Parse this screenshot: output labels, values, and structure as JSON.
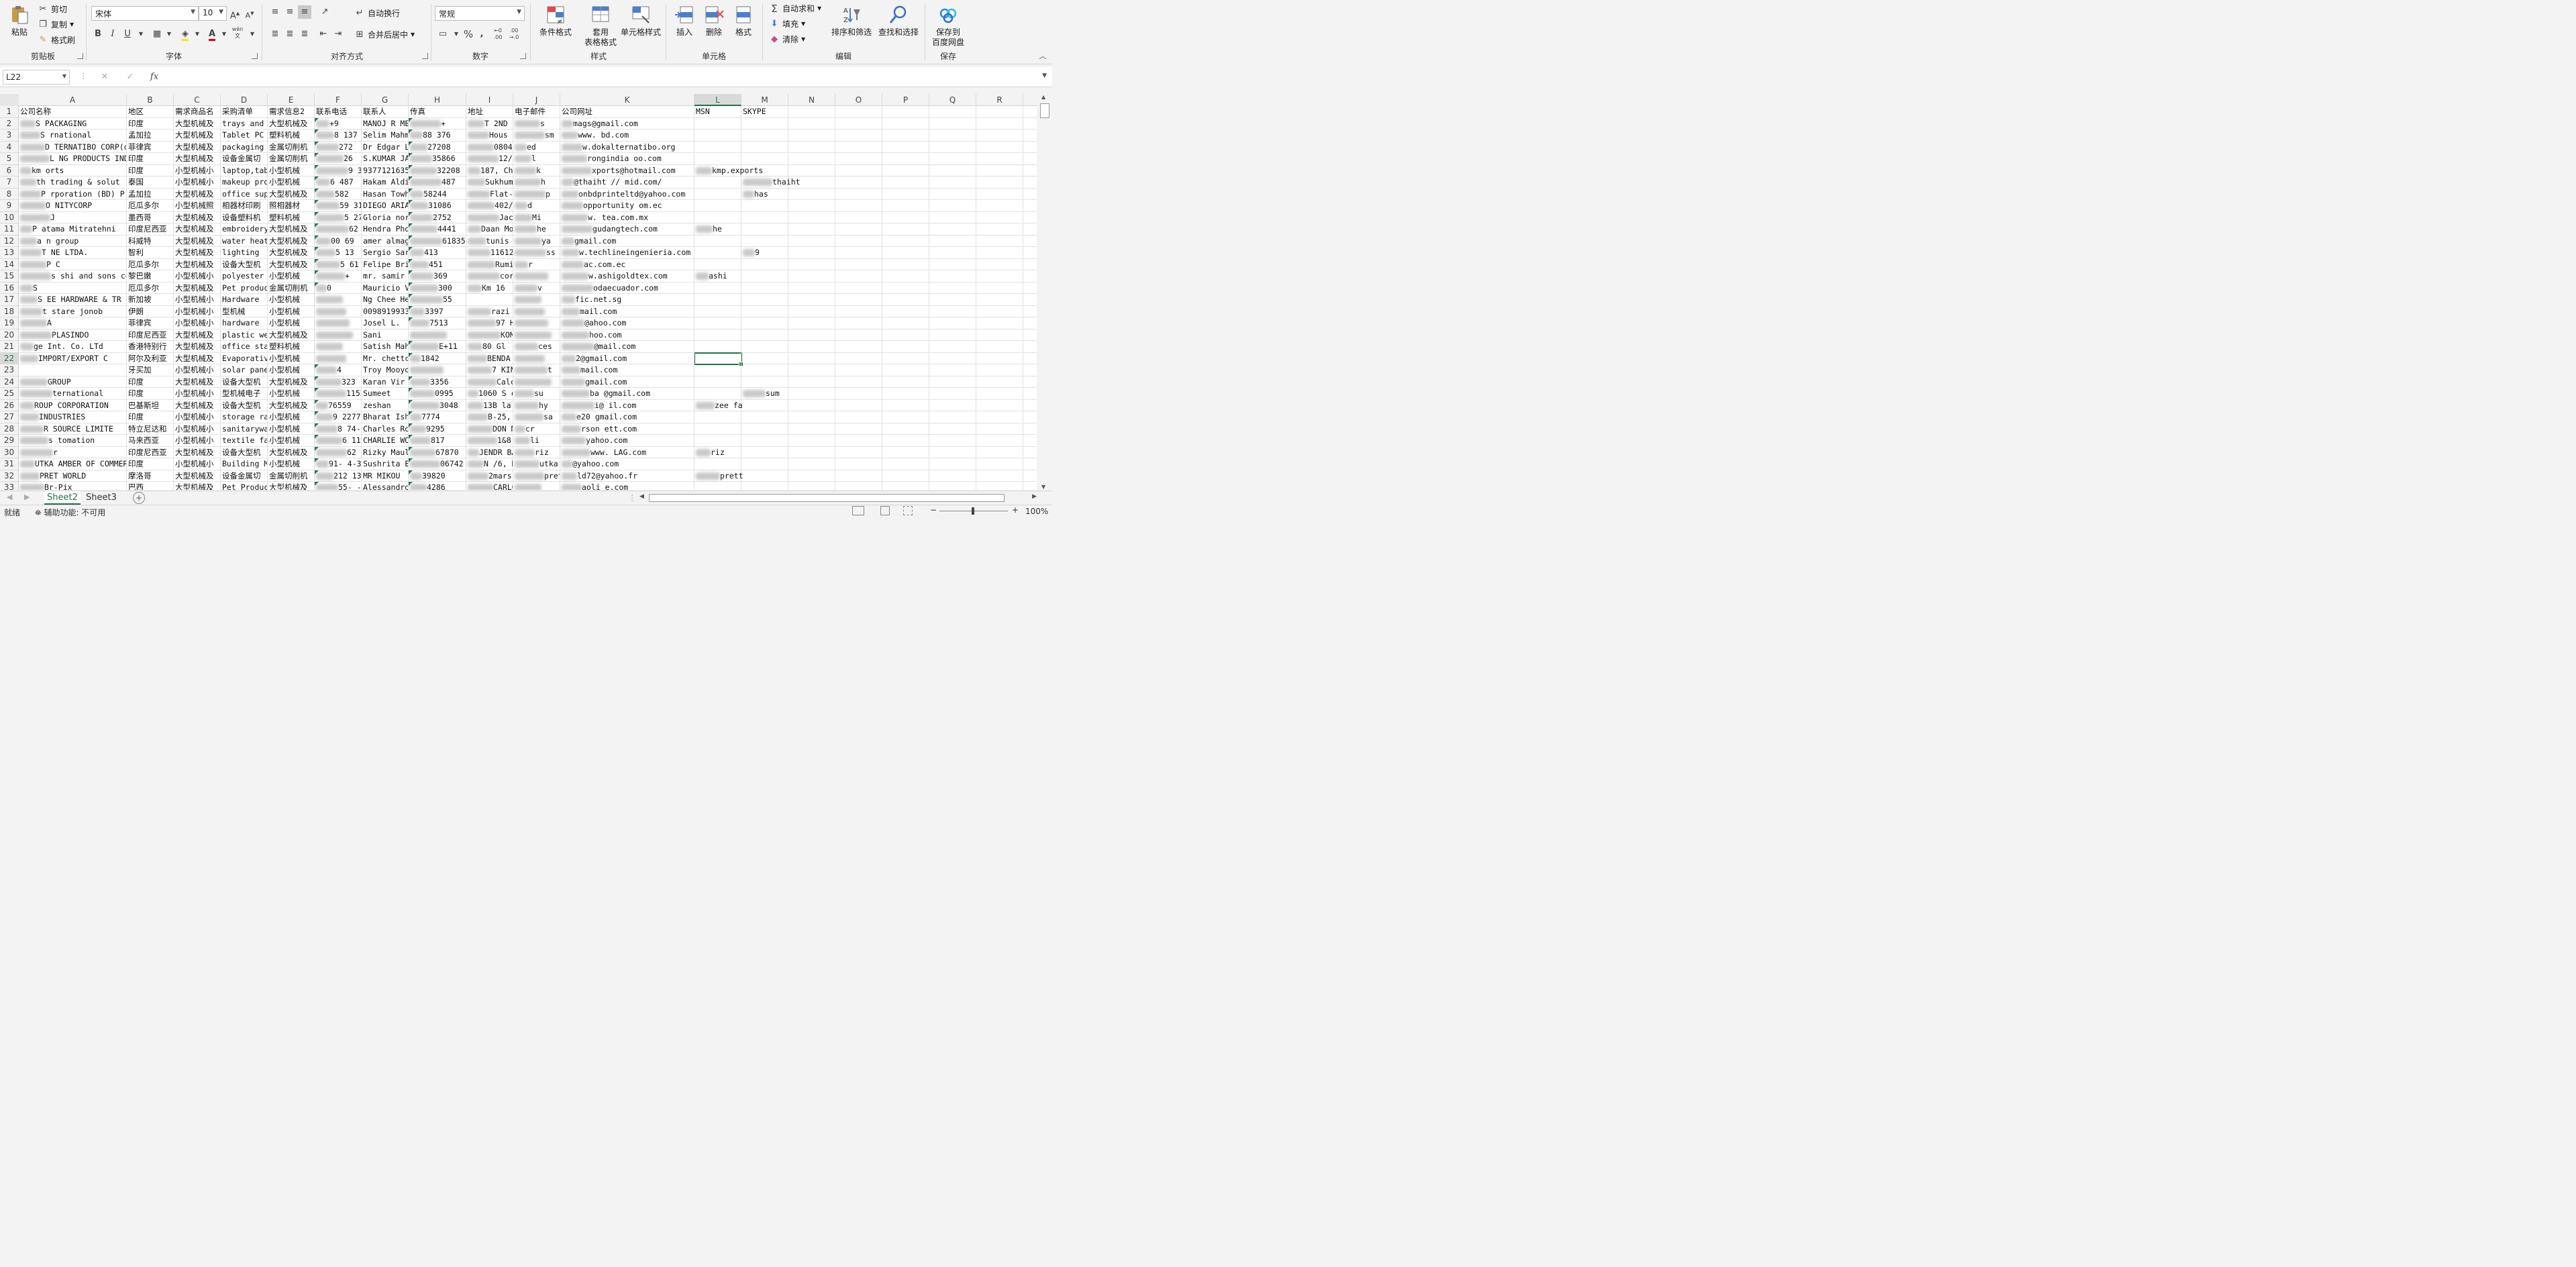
{
  "ribbon": {
    "clipboard": {
      "paste": "粘贴",
      "cut": "剪切",
      "copy": "复制",
      "format_painter": "格式刷",
      "group": "剪贴板"
    },
    "font": {
      "name": "宋体",
      "size": "10",
      "bold": "B",
      "italic": "I",
      "underline": "U",
      "phonetic": "wén",
      "group": "字体"
    },
    "alignment": {
      "wrap": "自动换行",
      "merge": "合并后居中",
      "group": "对齐方式"
    },
    "number": {
      "format": "常规",
      "percent": "%",
      "comma": ",",
      "group": "数字"
    },
    "styles": {
      "conditional": "条件格式",
      "table1": "套用",
      "table2": "表格格式",
      "cell_style": "单元格样式",
      "group": "样式"
    },
    "cells": {
      "insert": "插入",
      "delete": "删除",
      "format": "格式",
      "group": "单元格"
    },
    "editing": {
      "autosum": "自动求和",
      "fill": "填充",
      "clear": "清除",
      "sort": "排序和筛选",
      "find": "查找和选择",
      "group": "编辑"
    },
    "save": {
      "label1": "保存到",
      "label2": "百度网盘",
      "group": "保存"
    }
  },
  "formula_bar": {
    "name_box": "L22",
    "fx": "fx",
    "content": ""
  },
  "columns": [
    "A",
    "B",
    "C",
    "D",
    "E",
    "F",
    "G",
    "H",
    "I",
    "J",
    "K",
    "L",
    "M",
    "N",
    "O",
    "P",
    "Q",
    "R"
  ],
  "rows": [
    {
      "n": "1",
      "A": "公司名称",
      "B": "地区",
      "C": "需求商品名",
      "D": "采购清单",
      "E": "需求信息2",
      "F": "联系电话",
      "G": "联系人",
      "H": "传真",
      "I": "地址",
      "J": "电子邮件",
      "K": "公司网址",
      "L": "MSN",
      "M": "SKYPE"
    },
    {
      "n": "2",
      "A": "S PACKAGING",
      "B": "印度",
      "C": "大型机械及",
      "D": "trays and",
      "E": "大型机械及",
      "F": "+9",
      "G": "MANOJ R ME",
      "H": "+",
      "I": "T 2ND F",
      "J": "s",
      "K": "mags@gmail.com"
    },
    {
      "n": "3",
      "A": "S rnational",
      "B": "孟加拉",
      "C": "大型机械及",
      "D": "Tablet PC",
      "E": "塑料机械",
      "F": "8 137",
      "G": "Selim Mahm",
      "H": "88 376",
      "I": "Hous -34-3",
      "J": "sm",
      "K": "www. bd.com"
    },
    {
      "n": "4",
      "A": "D TERNATIBO CORP(da",
      "B": "菲律宾",
      "C": "大型机械及",
      "D": "packaging",
      "E": "金属切削机",
      "F": "272",
      "G": "Dr Edgar L",
      "H": "27208",
      "I": "0804 Roxas",
      "J": "ed",
      "K": "w.dokalternatibo.org"
    },
    {
      "n": "5",
      "A": "L NG PRODUCTS INDI",
      "B": "印度",
      "C": "大型机械及",
      "D": "设备金属切",
      "E": "金属切削机",
      "F": "26",
      "G": "S.KUMAR JA",
      "H": "35866",
      "I": "12/1 SHAK",
      "J": "l",
      "K": "rongindia oo.com"
    },
    {
      "n": "6",
      "A": "km orts",
      "B": "印度",
      "C": "小型机械小",
      "D": "laptop,tab",
      "E": "小型机械",
      "F": "9 32",
      "G": "9377121635",
      "H": "32208",
      "I": "187, Chandr",
      "J": "k",
      "K": "xports@hotmail.com",
      "L": "kmp.exports"
    },
    {
      "n": "7",
      "A": "th trading & solut",
      "B": "泰国",
      "C": "小型机械小",
      "D": "makeup pro",
      "E": "小型机械",
      "F": "6 487",
      "G": "Hakam Aldi",
      "H": "487",
      "I": "Sukhumvit",
      "J": "h",
      "K": "@thaiht //  mid.com/",
      "M": "thaiht"
    },
    {
      "n": "8",
      "A": "P rporation (BD) P",
      "B": "孟加拉",
      "C": "大型机械及",
      "D": "office sup",
      "E": "大型机械及",
      "F": "582",
      "G": "Hasan Towh",
      "H": "58244",
      "I": "Flat- 2,",
      "J": "p",
      "K": "onbdprinteltd@yahoo.com",
      "M": "has"
    },
    {
      "n": "9",
      "A": "O NITYCORP",
      "B": "厄瓜多尔",
      "C": "小型机械照",
      "D": "相器材印刷",
      "E": "照相器材",
      "F": "59 31",
      "G": "DIEGO ARIA",
      "H": "31086",
      "I": "402/ELIZ",
      "J": "d",
      "K": "opportunity om.ec"
    },
    {
      "n": "10",
      "A": "J",
      "B": "墨西哥",
      "C": "大型机械及",
      "D": "设备塑料机",
      "E": "塑料机械",
      "F": "5 27",
      "G": "Gloria nor",
      "H": "2752",
      "I": "Jacar dds",
      "J": "Mi",
      "K": "w. tea.com.mx"
    },
    {
      "n": "11",
      "A": "P atama Mitratehni",
      "B": "印度尼西亚",
      "C": "大型机械及",
      "D": "embroidery",
      "E": "大型机械及",
      "F": "62 44",
      "G": "Hendra Pho",
      "H": "4441",
      "I": "Daan Mogot",
      "J": "he",
      "K": "gudangtech.com",
      "L": "he"
    },
    {
      "n": "12",
      "A": "a n group",
      "B": "科威特",
      "C": "大型机械及",
      "D": "water heat",
      "E": "大型机械及",
      "F": "00 69",
      "G": "amer almag",
      "H": "61835",
      "I": "tunis kuwa",
      "J": "ya",
      "K": "gmail.com"
    },
    {
      "n": "13",
      "A": "T NE LTDA.",
      "B": "智利",
      "C": "大型机械及",
      "D": "lighting",
      "E": "大型机械及",
      "F": "5 13",
      "G": "Sergio Sar",
      "H": "413",
      "I": "11612 nto",
      "J": "ss",
      "K": "w.techlineingenieria.com",
      "M": "9"
    },
    {
      "n": "14",
      "A": "P C",
      "B": "厄瓜多尔",
      "C": "大型机械及",
      "D": "设备大型机",
      "E": "大型机械及",
      "F": "5 61",
      "G": "Felipe Bri",
      "H": "451",
      "I": "Rumih co",
      "J": "r",
      "K": "ac.com.ec"
    },
    {
      "n": "15",
      "A": "s shi and sons co.",
      "B": "黎巴嫩",
      "C": "小型机械小",
      "D": "polyester",
      "E": "小型机械",
      "F": "+",
      "G": "mr. samir",
      "H": "369",
      "I": "cornic ma",
      "J": "",
      "K": "w.ashigoldtex.com",
      "L": "ashi"
    },
    {
      "n": "16",
      "A": "S",
      "B": "厄瓜多尔",
      "C": "大型机械及",
      "D": "Pet produc",
      "E": "金属切削机",
      "F": "0",
      "G": "Mauricio V",
      "H": "300",
      "I": "Km 16",
      "J": "v",
      "K": "odaecuador.com"
    },
    {
      "n": "17",
      "A": "S EE HARDWARE & TR",
      "B": "新加坡",
      "C": "小型机械小",
      "D": "Hardware",
      "E": "小型机械",
      "F": "",
      "G": "Ng Chee He",
      "H": "55",
      "I": "",
      "J": "",
      "K": "fic.net.sg"
    },
    {
      "n": "18",
      "A": "t stare jonob",
      "B": "伊朗",
      "C": "小型机械小",
      "D": "型机械",
      "E": "小型机械",
      "F": "",
      "G": "0098919933",
      "H": "3397",
      "I": "razi  nda",
      "J": "",
      "K": "mail.com"
    },
    {
      "n": "19",
      "A": "A",
      "B": "菲律宾",
      "C": "小型机械小",
      "D": "hardware",
      "E": "小型机械",
      "F": "",
      "G": "Josel L.",
      "H": "7513",
      "I": "97 HYA INI",
      "J": "",
      "K": "@ahoo.com"
    },
    {
      "n": "20",
      "A": "PLASINDO",
      "B": "印度尼西亚",
      "C": "大型机械及",
      "D": "plastic we",
      "E": "大型机械及",
      "F": "",
      "G": "Sani",
      "H": "",
      "I": "KOMP. W LAK",
      "J": "",
      "K": "hoo.com"
    },
    {
      "n": "21",
      "A": "ge Int. Co. LTd",
      "B": "香港特别行",
      "C": "大型机械及",
      "D": "office sta",
      "E": "塑料机械",
      "F": "",
      "G": "Satish Mah",
      "H": "E+11",
      "I": "80 Gl",
      "J": "ces",
      "K": "@mail.com"
    },
    {
      "n": "22",
      "A": "IMPORT/EXPORT C",
      "B": "阿尔及利亚",
      "C": "大型机械及",
      "D": "Evaporativ",
      "E": "小型机械",
      "F": "",
      "G": "Mr. chettc",
      "H": "1842",
      "I": "BENDA HA",
      "J": "",
      "K": "2@gmail.com"
    },
    {
      "n": "23",
      "A": "",
      "B": "牙买加",
      "C": "小型机械小",
      "D": "solar pane",
      "E": "小型机械",
      "F": "4",
      "G": "Troy Mooyoun",
      "H": "",
      "I": "7 KINS NG",
      "J": "t",
      "K": "mail.com"
    },
    {
      "n": "24",
      "A": "GROUP",
      "B": "印度",
      "C": "大型机械及",
      "D": "设备大型机",
      "E": "大型机械及",
      "F": "323",
      "G": "Karan Vir",
      "H": "3356",
      "I": "Calcuta Cr",
      "J": "",
      "K": "gmail.com"
    },
    {
      "n": "25",
      "A": "ternational",
      "B": "印度",
      "C": "小型机械小",
      "D": "型机械电子",
      "E": "小型机械",
      "F": "11524",
      "G": "Sumeet",
      "H": "0995",
      "I": "1060 S ct",
      "J": "su",
      "K": "ba @gmail.com",
      "M": "sum"
    },
    {
      "n": "26",
      "A": "ROUP CORPORATION",
      "B": "巴基斯坦",
      "C": "大型机械及",
      "D": "设备大型机",
      "E": "大型机械及",
      "F": "76559",
      "G": "zeshan",
      "H": "3048",
      "I": "13B la ore",
      "J": "hy",
      "K": "i@ il.com",
      "L": "zee fa"
    },
    {
      "n": "27",
      "A": "INDUSTRIES",
      "B": "印度",
      "C": "小型机械小",
      "D": "storage ra",
      "E": "小型机械",
      "F": "9 2277",
      "G": "Bharat Ish",
      "H": "7774",
      "I": "B-25, HIT",
      "J": "sa",
      "K": "e20 gmail.com"
    },
    {
      "n": "28",
      "A": "R SOURCE LIMITE",
      "B": "特立尼达和",
      "C": "小型机械小",
      "D": "sanitarywa",
      "E": "小型机械",
      "F": "8 74-78",
      "G": "Charles Ro",
      "H": "9295",
      "I": "DON M EL",
      "J": "cr",
      "K": "rson ett.com"
    },
    {
      "n": "29",
      "A": "s tomation",
      "B": "马来西亚",
      "C": "小型机械小",
      "D": "textile fa",
      "E": "小型机械",
      "F": "6 11257",
      "G": "CHARLIE WO",
      "H": "817",
      "I": "1&8, N Ic",
      "J": "li",
      "K": "yahoo.com"
    },
    {
      "n": "30",
      "A": "r",
      "B": "印度尼西亚",
      "C": "大型机械及",
      "D": "设备大型机",
      "E": "大型机械及",
      "F": "62 92118",
      "G": "Rizky Maul",
      "H": "67870",
      "I": "JENDR BA",
      "J": "riz",
      "K": "www. LAG.com",
      "L": "riz"
    },
    {
      "n": "31",
      "A": "UTKA AMBER OF COMMER",
      "B": "印度",
      "C": "小型机械小",
      "D": "Building M",
      "E": "小型机械",
      "F": "91- 4-329",
      "G": "Sushrita E",
      "H": "06742",
      "I": "N /6, RC",
      "J": "utka",
      "K": "@yahoo.com"
    },
    {
      "n": "32",
      "A": "PRET WORLD",
      "B": "摩洛哥",
      "C": "大型机械及",
      "D": "设备金属切",
      "E": "金属切削机",
      "F": "212 13064",
      "G": "MR MIKOU",
      "H": "39820",
      "I": "2mars asa",
      "J": "pret",
      "K": "ld72@yahoo.fr",
      "L": "prett"
    },
    {
      "n": "33",
      "A": "Br-Pix",
      "B": "巴西",
      "C": "大型机械及",
      "D": "Pet Produc",
      "E": "大型机械及",
      "F": "55- -334",
      "G": "Alessandro",
      "H": "4286",
      "I": "CARLOS VON",
      "J": "",
      "K": "aoli e.com"
    }
  ],
  "sheets": [
    "Sheet2",
    "Sheet3"
  ],
  "status": {
    "ready": "就绪",
    "accessibility": "辅助功能: 不可用",
    "zoom": "100%"
  }
}
